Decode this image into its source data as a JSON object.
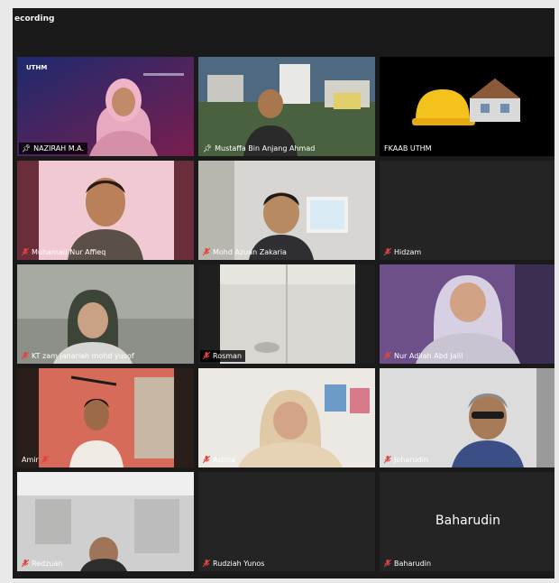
{
  "status": {
    "recording_label": "ecording"
  },
  "participants": [
    {
      "name": "NAZIRAH M.A.",
      "indicator": "pin-icon"
    },
    {
      "name": "Mustaffa Bin Anjang Ahmad",
      "indicator": "pin-icon"
    },
    {
      "name": "FKAAB UTHM",
      "indicator": "none"
    },
    {
      "name": "Muhamad Nur Affieq",
      "indicator": "mic-muted-icon"
    },
    {
      "name": "Mohd Azuan Zakaria",
      "indicator": "mic-muted-icon"
    },
    {
      "name": "Hidzam",
      "indicator": "mic-muted-icon"
    },
    {
      "name": "KT zam janariah mohd yusof",
      "indicator": "mic-muted-icon"
    },
    {
      "name": "Rosman",
      "indicator": "mic-muted-icon"
    },
    {
      "name": "Nur Adilah Abd Jalil",
      "indicator": "mic-muted-icon"
    },
    {
      "name": "Amir",
      "indicator": "mic-muted-icon"
    },
    {
      "name": "Astina",
      "indicator": "mic-muted-icon"
    },
    {
      "name": "Joharudin",
      "indicator": "mic-muted-icon"
    },
    {
      "name": "Redzuan",
      "indicator": "mic-muted-icon"
    },
    {
      "name": "Rudziah Yunos",
      "indicator": "mic-muted-icon"
    },
    {
      "name": "Baharudin",
      "indicator": "mic-muted-icon",
      "center_label": "Baharudin"
    }
  ],
  "branding": {
    "logo_text": "UTHM"
  },
  "colors": {
    "active_speaker": "#63c26a",
    "muted_mic": "#e0443b",
    "tile_bg": "#242424"
  }
}
